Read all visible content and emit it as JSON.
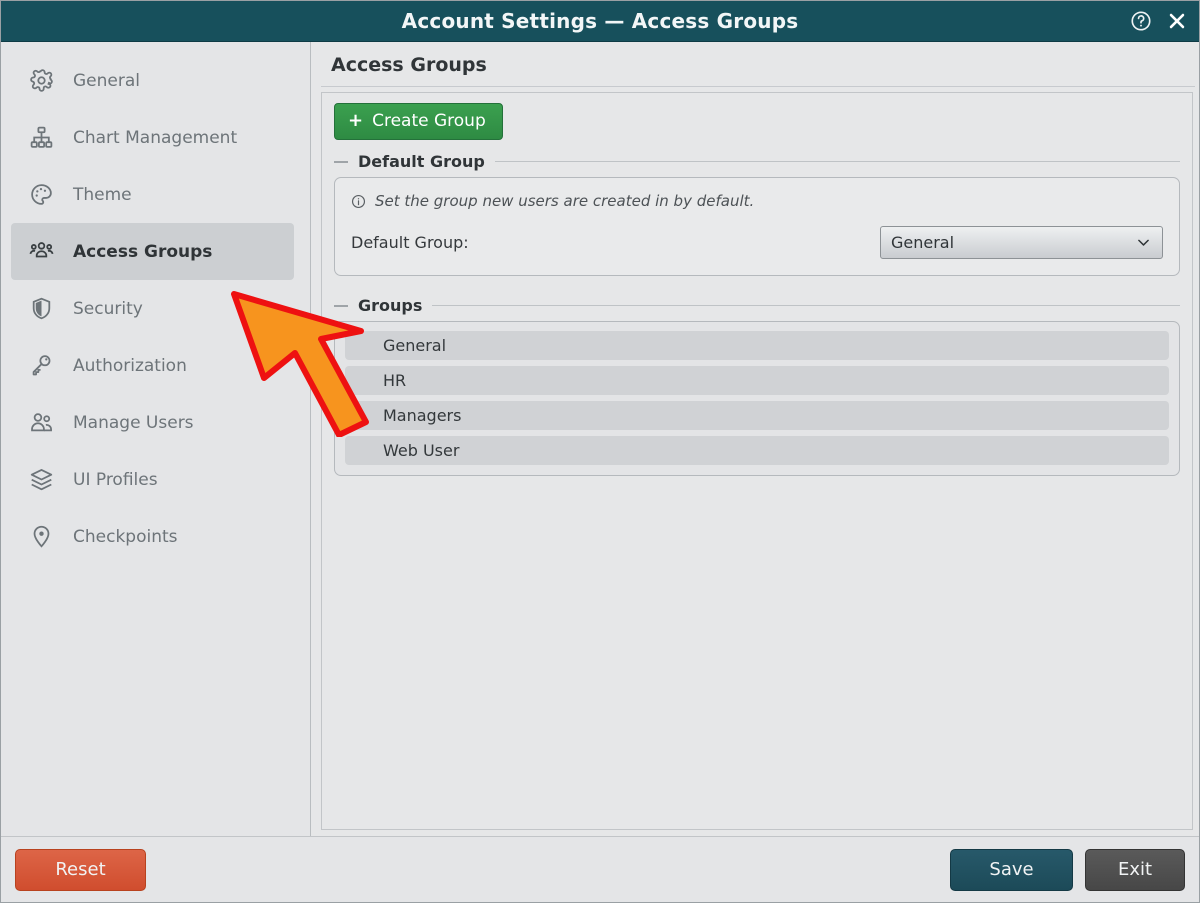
{
  "window": {
    "title": "Account Settings — Access Groups",
    "help_icon": "help-circle-icon",
    "close_icon": "close-icon"
  },
  "sidebar": {
    "items": [
      {
        "label": "General",
        "icon": "gear-icon",
        "active": false
      },
      {
        "label": "Chart Management",
        "icon": "sitemap-icon",
        "active": false
      },
      {
        "label": "Theme",
        "icon": "palette-icon",
        "active": false
      },
      {
        "label": "Access Groups",
        "icon": "user-group-icon",
        "active": true
      },
      {
        "label": "Security",
        "icon": "shield-icon",
        "active": false
      },
      {
        "label": "Authorization",
        "icon": "key-icon",
        "active": false
      },
      {
        "label": "Manage Users",
        "icon": "users-icon",
        "active": false
      },
      {
        "label": "UI Profiles",
        "icon": "layers-icon",
        "active": false
      },
      {
        "label": "Checkpoints",
        "icon": "map-pin-icon",
        "active": false
      }
    ]
  },
  "content": {
    "title": "Access Groups",
    "create_button": {
      "plus": "+",
      "label": "Create Group"
    },
    "default_group_section": {
      "legend": "Default Group",
      "info_icon": "info-circle-icon",
      "info_text": "Set the group new users are created in by default.",
      "field_label": "Default Group:",
      "select_value": "General",
      "select_options": [
        "General",
        "HR",
        "Managers",
        "Web User"
      ],
      "caret_icon": "chevron-down-icon"
    },
    "groups_section": {
      "legend": "Groups",
      "items": [
        "General",
        "HR",
        "Managers",
        "Web User"
      ]
    }
  },
  "footer": {
    "reset_label": "Reset",
    "save_label": "Save",
    "exit_label": "Exit"
  },
  "overlay": {
    "cursor_icon": "arrow-cursor-pointer",
    "fill_color": "#F7941E",
    "stroke_color": "#EE1111"
  },
  "colors": {
    "titlebar": "#17505c",
    "accent_green": "#2e8b43",
    "accent_orange": "#d9573c",
    "accent_teal": "#1c4a58"
  }
}
